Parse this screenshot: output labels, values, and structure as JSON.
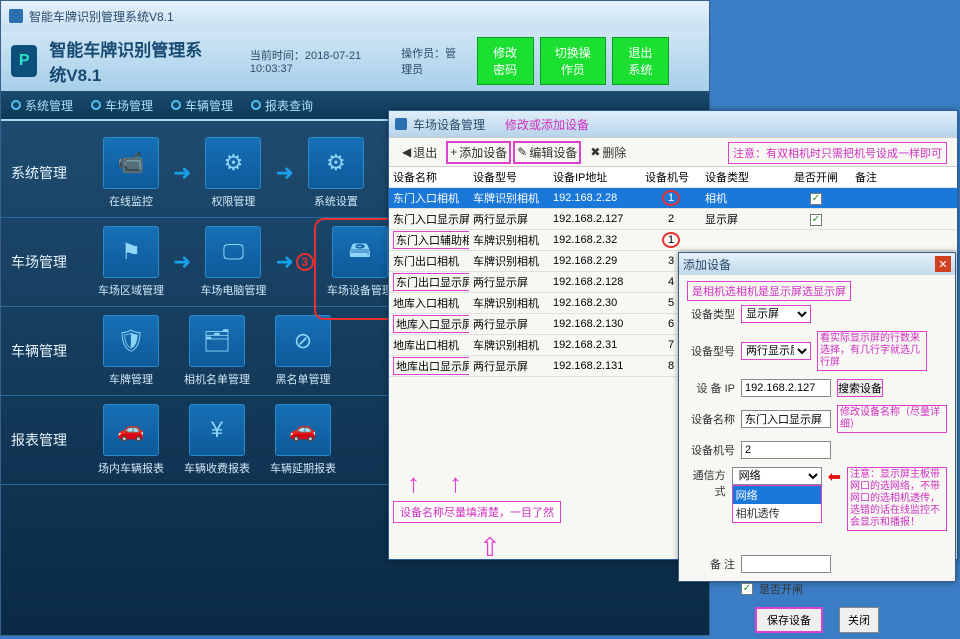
{
  "titlebar": "智能车牌识别管理系统V8.1",
  "app_title": "智能车牌识别管理系统V8.1",
  "time_label": "当前时间：2018-07-21 10:03:37",
  "operator": "操作员：管理员",
  "hd_btns": {
    "pw": "修改密码",
    "sw": "切换操作员",
    "exit": "退出系统"
  },
  "menus": [
    "系统管理",
    "车场管理",
    "车辆管理",
    "报表查询"
  ],
  "sections": [
    {
      "label": "系统管理",
      "tiles": [
        {
          "l": "在线监控",
          "i": "📹"
        },
        {
          "l": "权限管理",
          "i": "⚙"
        },
        {
          "l": "系统设置",
          "i": "⚙"
        }
      ]
    },
    {
      "label": "车场管理",
      "tiles": [
        {
          "l": "车场区域管理",
          "i": "⚑"
        },
        {
          "l": "车场电脑管理",
          "i": "🖵"
        },
        {
          "l": "车场设备管理",
          "i": "🖴",
          "ring": "3"
        }
      ]
    },
    {
      "label": "车辆管理",
      "tiles": [
        {
          "l": "车牌管理",
          "i": "🛡"
        },
        {
          "l": "相机名单管理",
          "i": "🗂"
        },
        {
          "l": "黑名单管理",
          "i": "⊘"
        }
      ]
    },
    {
      "label": "报表管理",
      "tiles": [
        {
          "l": "场内车辆报表",
          "i": "🚗"
        },
        {
          "l": "车辆收费报表",
          "i": "¥"
        },
        {
          "l": "车辆延期报表",
          "i": "🚗"
        }
      ]
    }
  ],
  "dev": {
    "win_title": "车场设备管理",
    "subtitle": "修改或添加设备",
    "toolbar": {
      "exit": "退出",
      "add": "添加设备",
      "edit": "编辑设备",
      "del": "删除"
    },
    "warn": "注意：有双相机时只需把机号设成一样即可",
    "cols": [
      "设备名称",
      "设备型号",
      "设备IP地址",
      "设备机号",
      "设备类型",
      "是否开闸",
      "备注"
    ],
    "rows": [
      {
        "n": "东门入口相机",
        "m": "车牌识别相机",
        "ip": "192.168.2.28",
        "no": "1",
        "t": "相机",
        "ck": true,
        "sel": true,
        "rn": true
      },
      {
        "n": "东门入口显示屏",
        "m": "两行显示屏",
        "ip": "192.168.2.127",
        "no": "2",
        "t": "显示屏",
        "ck": true
      },
      {
        "n": "东门入口辅助相机",
        "m": "车牌识别相机",
        "ip": "192.168.2.32",
        "no": "1",
        "rn": true,
        "pn": true
      },
      {
        "n": "东门出口相机",
        "m": "车牌识别相机",
        "ip": "192.168.2.29",
        "no": "3"
      },
      {
        "n": "东门出口显示屏",
        "m": "两行显示屏",
        "ip": "192.168.2.128",
        "no": "4",
        "pn": true
      },
      {
        "n": "地库入口相机",
        "m": "车牌识别相机",
        "ip": "192.168.2.30",
        "no": "5"
      },
      {
        "n": "地库入口显示屏",
        "m": "两行显示屏",
        "ip": "192.168.2.130",
        "no": "6",
        "pn": true
      },
      {
        "n": "地库出口相机",
        "m": "车牌识别相机",
        "ip": "192.168.2.31",
        "no": "7"
      },
      {
        "n": "地库出口显示屏",
        "m": "两行显示屏",
        "ip": "192.168.2.131",
        "no": "8",
        "pn": true
      }
    ],
    "footnote": "设备名称尽量填清楚，一目了然"
  },
  "add": {
    "title": "添加设备",
    "hint": "是相机选相机是显示屏选显示屏",
    "type_l": "设备类型",
    "type_v": "显示屏",
    "model_l": "设备型号",
    "model_v": "两行显示屏",
    "model_n": "看实际显示屏的行数来选择，有几行字就选几行屏",
    "ip_l": "设 备 IP",
    "ip_v": "192.168.2.127",
    "search": "搜索设备",
    "name_l": "设备名称",
    "name_v": "东门入口显示屏",
    "name_n": "修改设备名称（尽量详细）",
    "no_l": "设备机号",
    "no_v": "2",
    "comm_l": "通信方式",
    "comm_v": "网络",
    "opt1": "网络",
    "opt2": "相机透传",
    "comm_n": "注意：显示屏主板带网口的选网络，不带网口的选相机透传，选错的话在线监控不会显示和播报！",
    "remark_l": "备    注",
    "open": "是否开闸",
    "save": "保存设备",
    "close": "关闭"
  }
}
